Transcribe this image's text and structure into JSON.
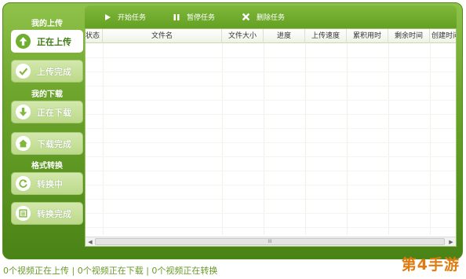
{
  "sidebar": {
    "upload_section": "我的上传",
    "download_section": "我的下载",
    "convert_section": "格式转换",
    "items": [
      {
        "label": "正在上传",
        "icon": "upload-arrow-icon",
        "active": true
      },
      {
        "label": "上传完成",
        "icon": "check-icon",
        "active": false
      },
      {
        "label": "正在下载",
        "icon": "download-arrow-icon",
        "active": false
      },
      {
        "label": "下载完成",
        "icon": "home-icon",
        "active": false
      },
      {
        "label": "转换中",
        "icon": "refresh-icon",
        "active": false
      },
      {
        "label": "转换完成",
        "icon": "list-icon",
        "active": false
      }
    ]
  },
  "toolbar": {
    "start_label": "开始任务",
    "pause_label": "暂停任务",
    "delete_label": "删除任务"
  },
  "table": {
    "columns": [
      "状态",
      "文件名",
      "文件大小",
      "进度",
      "上传速度",
      "累积用时",
      "剩余时间",
      "创建时间"
    ]
  },
  "scrollbar": {
    "left": "◀",
    "right": "▶",
    "thumb": "III"
  },
  "status": {
    "text": "0个视频正在上传 | 0个视频正在下载 | 0个视频正在转换"
  },
  "watermark": "第4手游",
  "colors": {
    "accent": "#6ea52c",
    "active_text": "#3d7a12",
    "status_text": "#6a9a2a",
    "watermark": "#e07b10"
  }
}
